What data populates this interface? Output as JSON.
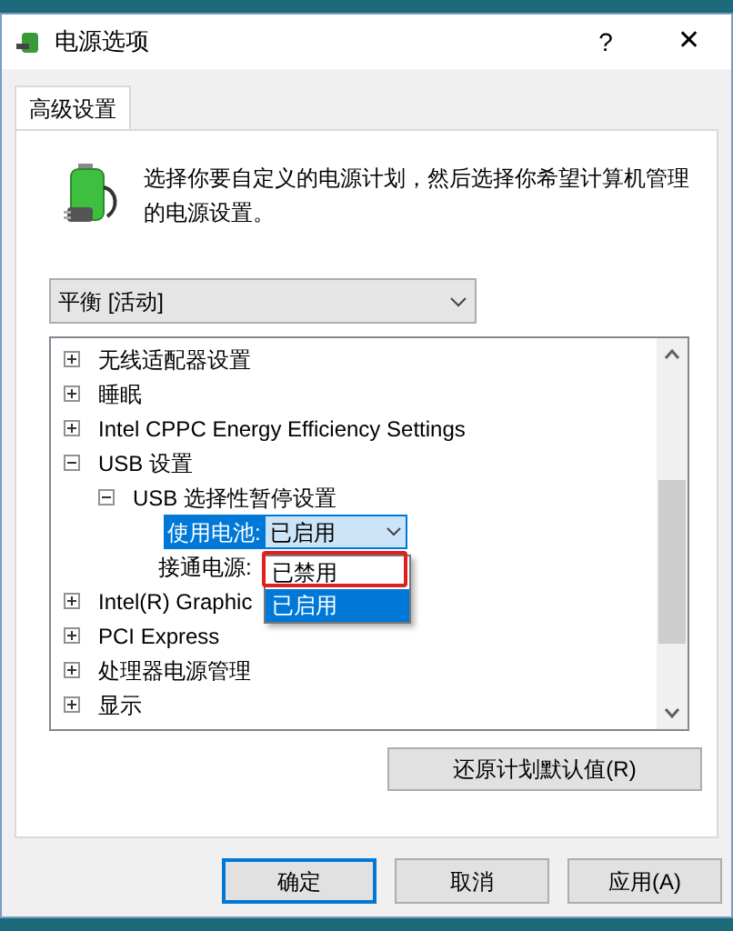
{
  "window": {
    "title": "电源选项",
    "help": "?",
    "close": "✕"
  },
  "tabs": [
    {
      "label": "高级设置",
      "selected": true
    }
  ],
  "description": "选择你要自定义的电源计划，然后选择你希望计算机管理的电源设置。",
  "plan_dropdown": {
    "value": "平衡 [活动]"
  },
  "tree": {
    "items": [
      {
        "kind": "group",
        "label": "无线适配器设置",
        "expanded": false
      },
      {
        "kind": "group",
        "label": "睡眠",
        "expanded": false
      },
      {
        "kind": "group",
        "label": "Intel CPPC Energy Efficiency Settings",
        "expanded": false
      },
      {
        "kind": "group",
        "label": "USB 设置",
        "expanded": true,
        "children": [
          {
            "kind": "group",
            "label": "USB 选择性暂停设置",
            "expanded": true,
            "children": [
              {
                "kind": "setting",
                "label": "使用电池:",
                "value": "已启用",
                "selected": true
              },
              {
                "kind": "setting",
                "label": "接通电源:",
                "selected": false
              }
            ]
          }
        ]
      },
      {
        "kind": "group",
        "label": "Intel(R) Graphic",
        "expanded": false
      },
      {
        "kind": "group",
        "label": "PCI Express",
        "expanded": false
      },
      {
        "kind": "group",
        "label": "处理器电源管理",
        "expanded": false
      },
      {
        "kind": "group",
        "label": "显示",
        "expanded": false
      }
    ]
  },
  "dropdown_popup": {
    "options": [
      {
        "label": "已禁用",
        "selected": false,
        "marked": true
      },
      {
        "label": "已启用",
        "selected": true,
        "marked": false
      }
    ]
  },
  "restore_button": "还原计划默认值(R)",
  "buttons": [
    {
      "label": "确定",
      "default": true
    },
    {
      "label": "取消",
      "default": false
    },
    {
      "label": "应用(A)",
      "default": false
    }
  ]
}
